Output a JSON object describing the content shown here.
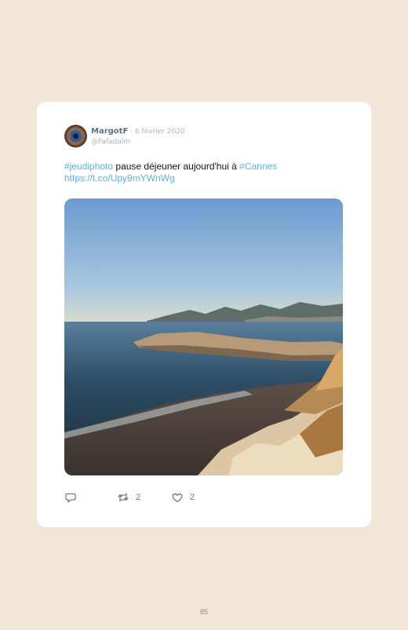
{
  "tweet": {
    "display_name": "MargotF",
    "separator": " · ",
    "date": "6 février 2020",
    "handle": "@Fafadalm",
    "text": {
      "hashtag1": "#jeudiphoto",
      "body": " pause déjeuner aujourd'hui à ",
      "hashtag2": "#Cannes",
      "url": "https://t.co/Upy9mYWnWg"
    },
    "photo_icon": "seaside-photo",
    "actions": {
      "reply_icon": "reply-icon",
      "retweet_icon": "retweet-icon",
      "retweet_count": "2",
      "like_icon": "heart-icon",
      "like_count": "2"
    }
  },
  "page_number": "85",
  "colors": {
    "background": "#f3e7da",
    "card": "#ffffff",
    "link": "#5bb2e6",
    "name": "#5d7386",
    "muted": "#a9b6c2"
  }
}
